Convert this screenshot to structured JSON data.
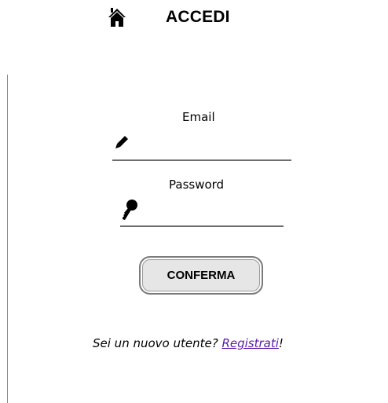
{
  "header": {
    "title": "ACCEDI",
    "home_icon": "home-icon"
  },
  "form": {
    "email_label": "Email",
    "email_value": "",
    "email_placeholder": "",
    "email_icon": "pencil-icon",
    "password_label": "Password",
    "password_value": "",
    "password_placeholder": "",
    "password_icon": "key-icon",
    "submit_label": "CONFERMA"
  },
  "footer": {
    "prompt": "Sei un nuovo utente? ",
    "link_label": "Registrati",
    "suffix": "!"
  },
  "colors": {
    "link": "#5b1aa8",
    "button_bg": "#e6e6e6",
    "underline": "#6e6e6e"
  }
}
